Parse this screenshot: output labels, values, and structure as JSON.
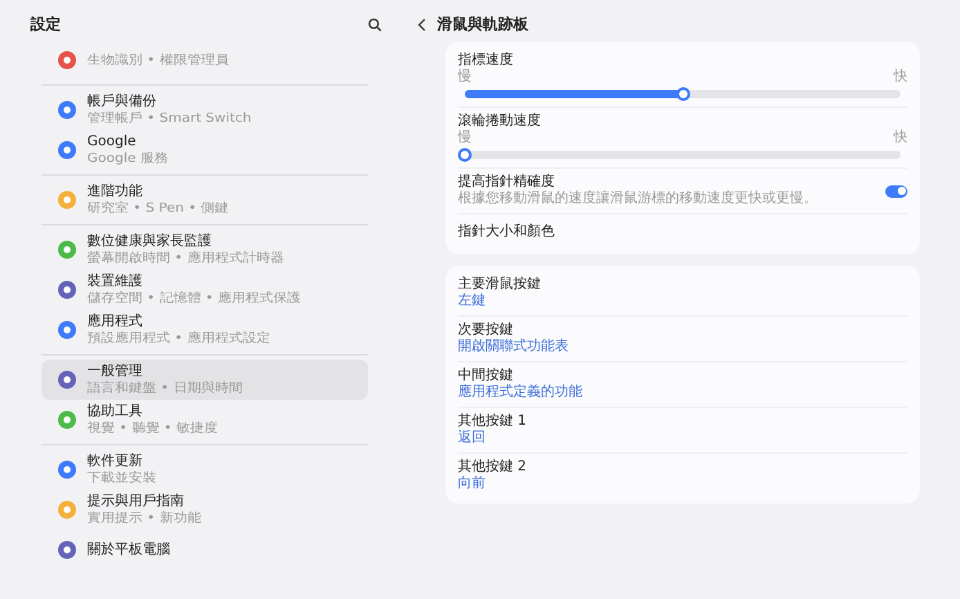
{
  "sidebar": {
    "title": "設定",
    "groups": [
      {
        "items": [
          {
            "subtitle": "生物識別 • 權限管理員",
            "color": "#e5534b",
            "selected": false
          }
        ]
      },
      {
        "items": [
          {
            "title": "帳戶與備份",
            "subtitle": "管理帳戶 • Smart Switch",
            "color": "#3e7bfa",
            "selected": false
          },
          {
            "title": "Google",
            "subtitle": "Google 服務",
            "color": "#3e7bfa",
            "selected": false
          }
        ]
      },
      {
        "items": [
          {
            "title": "進階功能",
            "subtitle": "研究室 • S Pen • 側鍵",
            "color": "#f5b03c",
            "selected": false
          }
        ]
      },
      {
        "items": [
          {
            "title": "數位健康與家長監護",
            "subtitle": "螢幕開啟時間 • 應用程式計時器",
            "color": "#4cbb4a",
            "selected": false
          },
          {
            "title": "裝置維護",
            "subtitle": "儲存空間 • 記憶體 • 應用程式保護",
            "color": "#6563b9",
            "selected": false
          },
          {
            "title": "應用程式",
            "subtitle": "預設應用程式 • 應用程式設定",
            "color": "#3e7bfa",
            "selected": false
          }
        ]
      },
      {
        "items": [
          {
            "title": "一般管理",
            "subtitle": "語言和鍵盤 • 日期與時間",
            "color": "#6563b9",
            "selected": true
          },
          {
            "title": "協助工具",
            "subtitle": "視覺 • 聽覺 • 敏捷度",
            "color": "#4cbb4a",
            "selected": false
          }
        ]
      },
      {
        "items": [
          {
            "title": "軟件更新",
            "subtitle": "下載並安裝",
            "color": "#3e7bfa",
            "selected": false
          },
          {
            "title": "提示與用戶指南",
            "subtitle": "實用提示 • 新功能",
            "color": "#f5b03c",
            "selected": false
          },
          {
            "title": "關於平板電腦",
            "color": "#6563b9",
            "selected": false
          }
        ]
      }
    ]
  },
  "page": {
    "title": "滑鼠與軌跡板",
    "cards": [
      {
        "rows": [
          {
            "kind": "slider",
            "title": "指標速度",
            "min_label": "慢",
            "max_label": "快",
            "level": 0.5
          },
          {
            "kind": "slider",
            "title": "滾輪捲動速度",
            "min_label": "慢",
            "max_label": "快",
            "level": 0
          },
          {
            "kind": "toggle",
            "title": "提高指針精確度",
            "subtitle": "根據您移動滑鼠的速度讓滑鼠游標的移動速度更快或更慢。",
            "on": true
          },
          {
            "kind": "link",
            "title": "指針大小和顏色"
          }
        ]
      },
      {
        "rows": [
          {
            "kind": "link",
            "title": "主要滑鼠按鍵",
            "value": "左鍵"
          },
          {
            "kind": "link",
            "title": "次要按鍵",
            "value": "開啟關聯式功能表"
          },
          {
            "kind": "link",
            "title": "中間按鍵",
            "value": "應用程式定義的功能"
          },
          {
            "kind": "link",
            "title": "其他按鍵 1",
            "value": "返回"
          },
          {
            "kind": "link",
            "title": "其他按鍵 2",
            "value": "向前"
          }
        ]
      }
    ]
  }
}
